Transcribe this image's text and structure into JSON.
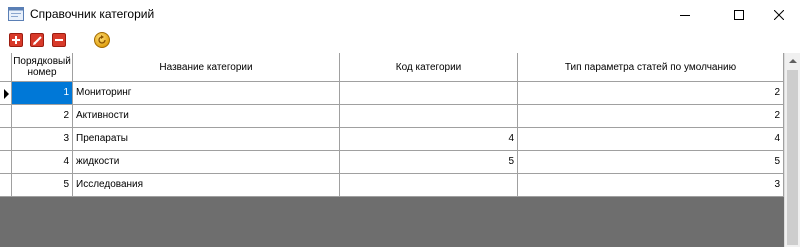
{
  "window": {
    "title": "Справочник категорий"
  },
  "toolbar": {
    "buttons": [
      {
        "name": "add",
        "icon": "plus-icon"
      },
      {
        "name": "edit",
        "icon": "pencil-icon"
      },
      {
        "name": "delete",
        "icon": "minus-icon"
      },
      {
        "name": "refresh",
        "icon": "refresh-icon"
      }
    ]
  },
  "table": {
    "columns": [
      "Порядковый номер",
      "Название категории",
      "Код категории",
      "Тип параметра статей по умолчанию"
    ],
    "rows": [
      {
        "order": "1",
        "name": "Мониторинг",
        "code": "",
        "type": "2"
      },
      {
        "order": "2",
        "name": "Активности",
        "code": "",
        "type": "2"
      },
      {
        "order": "3",
        "name": "Препараты",
        "code": "4",
        "type": "4"
      },
      {
        "order": "4",
        "name": "жидкости",
        "code": "5",
        "type": "5"
      },
      {
        "order": "5",
        "name": "Исследования",
        "code": "",
        "type": "3"
      }
    ],
    "selected_row": 1
  },
  "colors": {
    "selection": "#0078d7",
    "toolbar_button": "#d83a2a",
    "empty_area": "#6e6e6e"
  }
}
